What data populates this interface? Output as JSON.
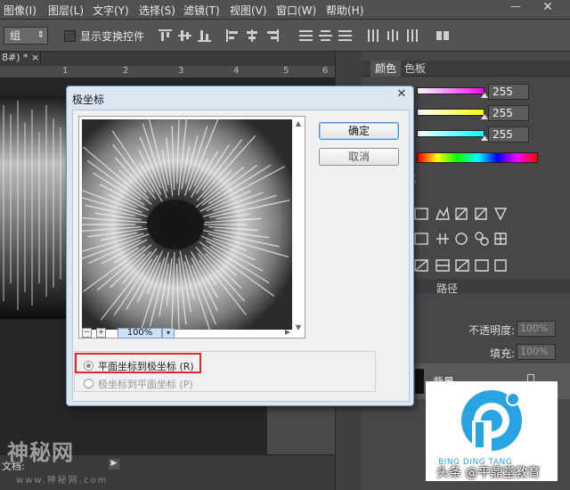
{
  "menubar": {
    "items": [
      "图像(I)",
      "图层(L)",
      "文字(Y)",
      "选择(S)",
      "滤镜(T)",
      "视图(V)",
      "窗口(W)",
      "帮助(H)"
    ],
    "minimize": "—",
    "close": "✕"
  },
  "options_bar": {
    "group_select": "组",
    "show_transform_label": "显示变换控件"
  },
  "document": {
    "tab_label": "8#) * ×",
    "ruler_ticks": [
      "1",
      "2",
      "3",
      "4",
      "5",
      "6"
    ],
    "status_text": "文档:",
    "status_arrow": "▶"
  },
  "watermark": {
    "main": "神秘网",
    "sub": "www.神秘网.com"
  },
  "color_panel": {
    "tab_color": "颜色",
    "tab_swatches": "色板",
    "values": [
      "255",
      "255",
      "255"
    ],
    "slider_colors": [
      "#ff00ff",
      "#ffff00",
      "#00ffff"
    ]
  },
  "adjustments_panel": {
    "partial_label": "式"
  },
  "layers_panel": {
    "tab_paths": "路径",
    "opacity_label": "不透明度:",
    "opacity_value": "100%",
    "fill_label": "填充:",
    "fill_value": "100%",
    "layer_name": "背景"
  },
  "dialog": {
    "title": "极坐标",
    "close": "✕",
    "ok_label": "确定",
    "cancel_label": "取消",
    "zoom_value": "100%",
    "zoom_minus": "−",
    "zoom_plus": "+",
    "zoom_dropdown": "▾",
    "scroll_up": "▲",
    "scroll_down": "▼",
    "scroll_right": "▶",
    "option_rect_to_polar": "平面坐标到极坐标 (R)",
    "option_polar_to_rect": "极坐标到平面坐标 (P)",
    "selected_option": "rect_to_polar"
  },
  "logo": {
    "caption": "BING DING TANG",
    "brand_color": "#2aa3e2"
  },
  "credit": "头条 @平鼎堂教育",
  "colors": {
    "highlight": "#e0282a",
    "dialog_bg": "#f0f0f0",
    "workspace": "#3b3b3b"
  }
}
